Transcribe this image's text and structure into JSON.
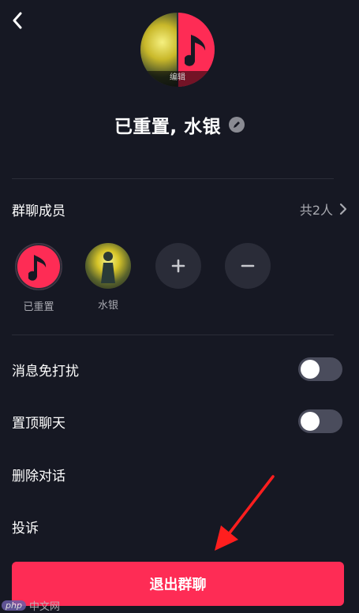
{
  "header": {
    "back_icon": "chevron-left-icon",
    "avatar_edit_label": "编辑"
  },
  "group": {
    "name": "已重置, 水银"
  },
  "members_section": {
    "label": "群聊成员",
    "count_text": "共2人",
    "members": [
      {
        "name": "已重置",
        "avatar": "red-music-note-avatar"
      },
      {
        "name": "水银",
        "avatar": "anime-character-avatar"
      }
    ],
    "add_icon": "plus-icon",
    "remove_icon": "minus-icon"
  },
  "settings": {
    "mute_label": "消息免打扰",
    "mute_on": false,
    "pin_label": "置顶聊天",
    "pin_on": false,
    "delete_label": "删除对话",
    "report_label": "投诉"
  },
  "exit_button": {
    "label": "退出群聊"
  },
  "watermark": {
    "logo": "php",
    "text": "中文网"
  },
  "colors": {
    "background": "#161823",
    "accent": "#fe2c55",
    "toggle_off": "#4a4c5c",
    "secondary_text": "#a8a9b0"
  }
}
